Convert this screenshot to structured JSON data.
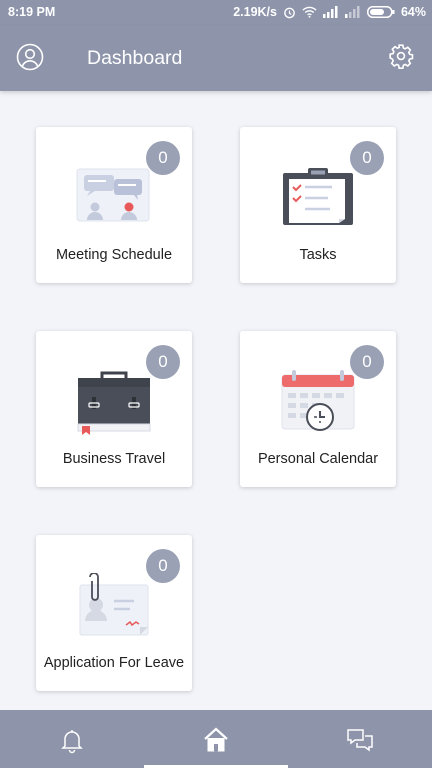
{
  "status_bar": {
    "time": "8:19 PM",
    "network_speed": "2.19K/s",
    "battery": "64%"
  },
  "header": {
    "title": "Dashboard",
    "profile_icon": "user-circle-icon",
    "settings_icon": "gear-icon"
  },
  "tiles": [
    {
      "label": "Meeting Schedule",
      "count": "0",
      "icon": "meeting-chat-icon"
    },
    {
      "label": "Tasks",
      "count": "0",
      "icon": "clipboard-checklist-icon"
    },
    {
      "label": "Business Travel",
      "count": "0",
      "icon": "briefcase-icon"
    },
    {
      "label": "Personal Calendar",
      "count": "0",
      "icon": "calendar-clock-icon"
    },
    {
      "label": "Application For Leave",
      "count": "0",
      "icon": "leave-document-icon"
    }
  ],
  "bottom_nav": {
    "items": [
      "notifications-bell-icon",
      "home-icon",
      "chat-bubbles-icon"
    ],
    "active": "home"
  },
  "colors": {
    "bar": "#8e95ab",
    "badge": "#9aa1b5",
    "background": "#f2f4f9",
    "accent_red": "#e85a5a"
  }
}
